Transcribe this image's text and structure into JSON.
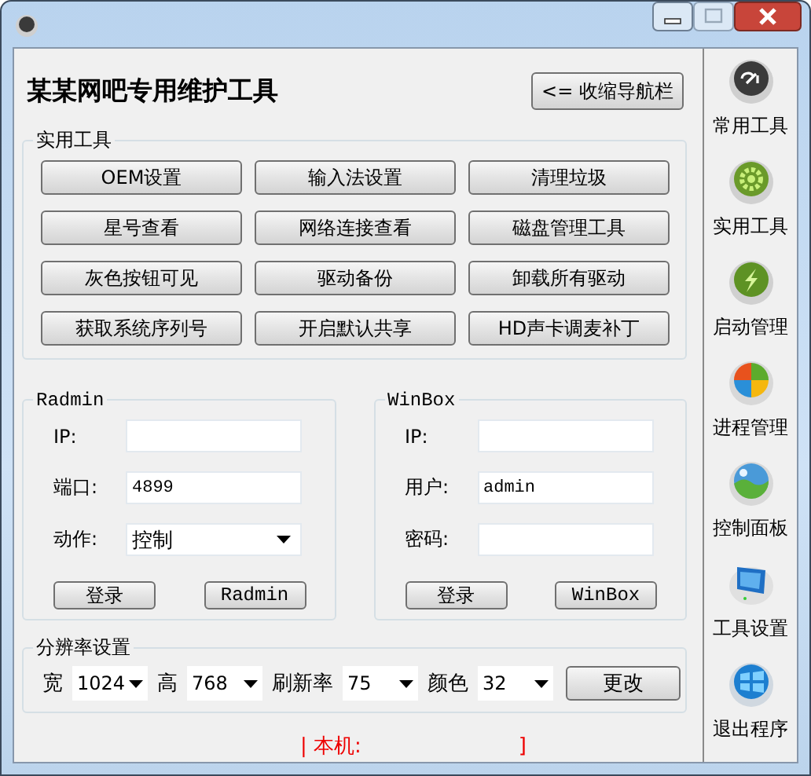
{
  "heading": "某某网吧专用维护工具",
  "collapse_button": "<= 收缩导航栏",
  "tools": {
    "title": "实用工具",
    "buttons": [
      "OEM设置",
      "输入法设置",
      "清理垃圾",
      "星号查看",
      "网络连接查看",
      "磁盘管理工具",
      "灰色按钮可见",
      "驱动备份",
      "卸载所有驱动",
      "获取系统序列号",
      "开启默认共享",
      "HD声卡调麦补丁"
    ]
  },
  "radmin": {
    "title": "Radmin",
    "fields": [
      {
        "kind": "input",
        "label": "IP:"
      },
      {
        "kind": "input",
        "label": "端口:",
        "value": "4899"
      },
      {
        "kind": "dropdown",
        "label": "动作:",
        "value": "控制"
      }
    ],
    "buttons": [
      "登录",
      "Radmin"
    ]
  },
  "winbox": {
    "title": "WinBox",
    "fields": [
      {
        "kind": "input",
        "label": "IP:"
      },
      {
        "kind": "input",
        "label": "用户:",
        "value": "admin"
      },
      {
        "kind": "input",
        "label": "密码:"
      }
    ],
    "buttons": [
      "登录",
      "WinBox"
    ]
  },
  "resolution": {
    "title": "分辨率设置",
    "selects": [
      {
        "label": "宽",
        "value": "1024"
      },
      {
        "label": "高",
        "value": "768"
      },
      {
        "label": "刷新率",
        "value": "75"
      },
      {
        "label": "颜色",
        "value": "32"
      }
    ],
    "button": "更改"
  },
  "status_bar": [
    "| 本机:",
    "]"
  ],
  "sidebar": {
    "items": [
      {
        "kind": "disc",
        "label": "常用工具"
      },
      {
        "kind": "gear",
        "label": "实用工具"
      },
      {
        "kind": "lightning",
        "label": "启动管理"
      },
      {
        "kind": "pinwheel",
        "label": "进程管理"
      },
      {
        "kind": "landscape",
        "label": "控制面板"
      },
      {
        "kind": "monitor",
        "label": "工具设置"
      },
      {
        "kind": "panes",
        "label": "退出程序"
      }
    ]
  }
}
